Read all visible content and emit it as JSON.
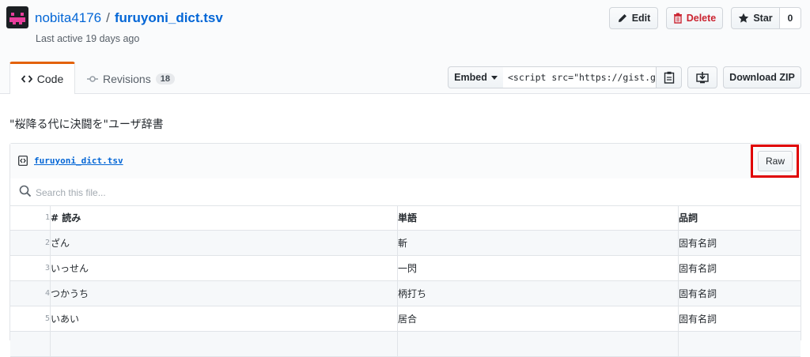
{
  "gist": {
    "owner": "nobita4176",
    "separator": "/",
    "name": "furuyoni_dict.tsv",
    "last_active": "Last active 19 days ago"
  },
  "actions": {
    "edit_label": "Edit",
    "delete_label": "Delete",
    "star_label": "Star",
    "star_count": "0"
  },
  "tabs": [
    {
      "label": "Code"
    },
    {
      "label": "Revisions",
      "count": "18"
    }
  ],
  "embed": {
    "label": "Embed",
    "value": "<script src=\"https://gist.g",
    "download_zip_label": "Download ZIP"
  },
  "description": "\"桜降る代に決闘を\"ユーザ辞書",
  "file": {
    "name": "furuyoni_dict.tsv",
    "raw_label": "Raw",
    "search_placeholder": "Search this file...",
    "rows": [
      {
        "line": "1",
        "cells": [
          "# 読み",
          "単語",
          "品詞"
        ]
      },
      {
        "line": "2",
        "cells": [
          "ざん",
          "斬",
          "固有名詞"
        ]
      },
      {
        "line": "3",
        "cells": [
          "いっせん",
          "一閃",
          "固有名詞"
        ]
      },
      {
        "line": "4",
        "cells": [
          "つかうち",
          "柄打ち",
          "固有名詞"
        ]
      },
      {
        "line": "5",
        "cells": [
          "いあい",
          "居合",
          "固有名詞"
        ]
      },
      {
        "line": "",
        "cells": [
          "",
          "",
          ""
        ]
      }
    ]
  },
  "colors": {
    "link": "#0366d6",
    "danger": "#cb2431",
    "tab_accent": "#e36209",
    "highlight": "#e00000",
    "avatar_bg": "#1b1f23",
    "avatar_fg": "#e83e9c"
  },
  "icons": [
    "code-icon",
    "history-icon",
    "pencil-icon",
    "trash-icon",
    "star-icon",
    "caret-down-icon",
    "clipboard-icon",
    "desktop-download-icon",
    "file-code-icon",
    "search-icon"
  ]
}
